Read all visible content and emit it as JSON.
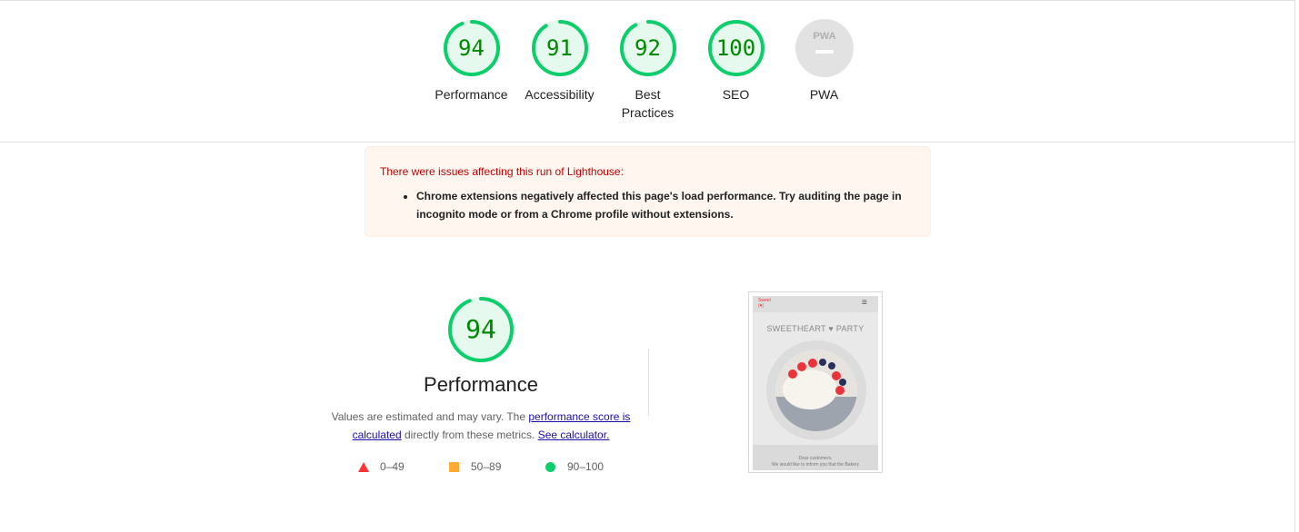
{
  "categories": [
    {
      "label": "Performance",
      "score": "94",
      "value": 94,
      "color": "#0cce6b"
    },
    {
      "label": "Accessibility",
      "score": "91",
      "value": 91,
      "color": "#0cce6b"
    },
    {
      "label": "Best\nPractices",
      "score": "92",
      "value": 92,
      "color": "#0cce6b"
    },
    {
      "label": "SEO",
      "score": "100",
      "value": 100,
      "color": "#0cce6b"
    },
    {
      "label": "PWA",
      "score": "PWA",
      "value": null,
      "color": "#cccccc"
    }
  ],
  "warning": {
    "title": "There were issues affecting this run of Lighthouse:",
    "items": [
      "Chrome extensions negatively affected this page's load performance. Try auditing the page in incognito mode or from a Chrome profile without extensions."
    ]
  },
  "performance": {
    "score": "94",
    "value": 94,
    "title": "Performance",
    "desc_prefix": "Values are estimated and may vary. The ",
    "desc_link1": "performance score is calculated",
    "desc_middle": " directly from these metrics. ",
    "desc_link2": "See calculator."
  },
  "legend": [
    {
      "range": "0–49",
      "shape": "triangle",
      "color": "#ff3333"
    },
    {
      "range": "50–89",
      "shape": "square",
      "color": "#ffaa33"
    },
    {
      "range": "90–100",
      "shape": "circle",
      "color": "#0cce6b"
    }
  ],
  "screenshot": {
    "logo_line1": "Sweet",
    "logo_line2": "(♥)",
    "menu_icon": "hamburger-icon",
    "brand": "SWEETHEART ♥ PARTY",
    "notice_line1": "Dear customers,",
    "notice_line2": "We would like to inform you that the Bakery"
  }
}
